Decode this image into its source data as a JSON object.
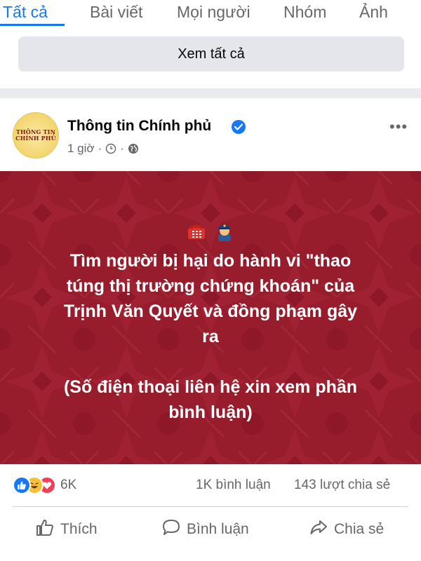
{
  "tabs": [
    {
      "label": "Tất cả",
      "active": true
    },
    {
      "label": "Bài viết",
      "active": false
    },
    {
      "label": "Mọi người",
      "active": false
    },
    {
      "label": "Nhóm",
      "active": false
    },
    {
      "label": "Ảnh",
      "active": false
    }
  ],
  "see_all_label": "Xem tất cả",
  "post": {
    "avatar_text": [
      "THÔNG TIN",
      "CHÍNH PHỦ"
    ],
    "author": "Thông tin Chính phủ",
    "time": "1 giờ",
    "icons": [
      "telephone-icon",
      "police-officer-icon"
    ],
    "text_lines": [
      "Tìm người bị hại do hành vi \"thao",
      "túng thị trường chứng khoán\" của",
      "Trịnh Văn Quyết và đồng phạm gây",
      "ra"
    ],
    "note_lines": [
      "(Số điện thoại liên hệ xin xem phần",
      "bình luận)"
    ],
    "reaction_count": "6K",
    "comments": "1K bình luận",
    "shares": "143 lượt chia sẻ"
  },
  "actions": {
    "like": "Thích",
    "comment": "Bình luận",
    "share": "Chia sẻ"
  },
  "colors": {
    "accent": "#1877f2",
    "image_bg": "#9b1f2e",
    "muted_text": "#65676b"
  }
}
